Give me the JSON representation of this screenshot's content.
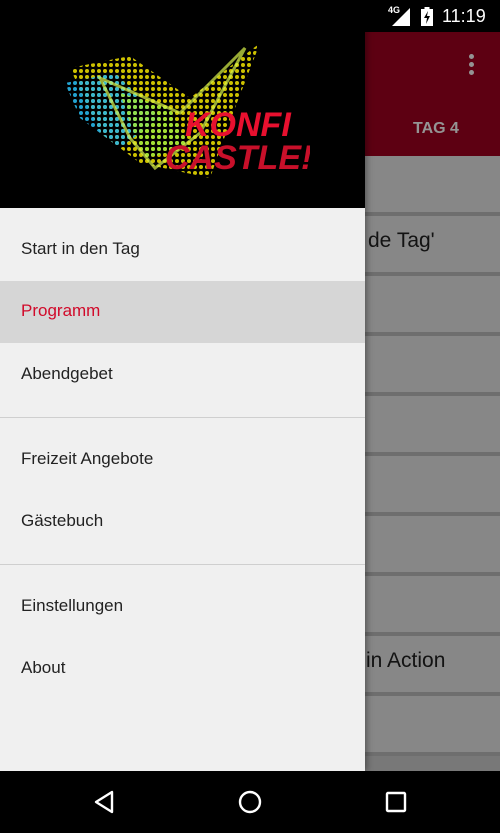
{
  "status_bar": {
    "network": "4G",
    "time": "11:19"
  },
  "toolbar": {
    "tab_visible": "TAG 4",
    "accent_color": "#a0001f"
  },
  "content": {
    "rows": [
      "",
      "de Tag'",
      "",
      "",
      "",
      "",
      "",
      "",
      "in Action",
      ""
    ]
  },
  "drawer": {
    "logo": {
      "line1": "KONFI",
      "line2": "CASTLE!"
    },
    "section1": [
      {
        "label": "Start in den Tag"
      },
      {
        "label": "Programm",
        "active": true
      },
      {
        "label": "Abendgebet"
      }
    ],
    "section2": [
      {
        "label": "Freizeit Angebote"
      },
      {
        "label": "Gästebuch"
      }
    ],
    "section3": [
      {
        "label": "Einstellungen"
      },
      {
        "label": "About"
      }
    ],
    "active_color": "#d10a2a"
  },
  "nav_bar": {
    "icons": [
      "back-icon",
      "home-icon",
      "recents-icon"
    ]
  }
}
